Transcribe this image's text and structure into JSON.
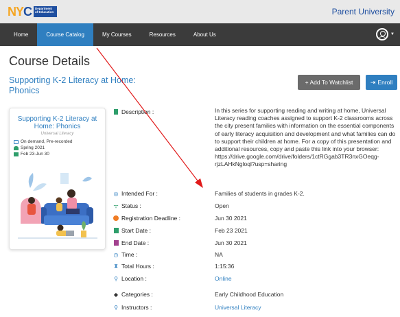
{
  "brand": {
    "logo_text": "NYC",
    "dept_text": "Department of Education",
    "site_title": "Parent University"
  },
  "nav": {
    "items": [
      {
        "label": "Home"
      },
      {
        "label": "Course Catalog"
      },
      {
        "label": "My Courses"
      },
      {
        "label": "Resources"
      },
      {
        "label": "About Us"
      }
    ],
    "active_index": 1
  },
  "page": {
    "title": "Course Details",
    "course_title": "Supporting K-2 Literacy at Home: Phonics"
  },
  "actions": {
    "watchlist_label": "+ Add To Watchlist",
    "enroll_label": "Enroll"
  },
  "card": {
    "title": "Supporting K-2 Literacy at Home: Phonics",
    "subtitle": "Universal Literacy",
    "format": "On demand, Pre-recorded",
    "term": "Spring 2021",
    "dates": "Feb 23-Jun 30"
  },
  "details": {
    "description_label": "Description :",
    "description": "In this series for supporting reading and writing at home, Universal Literacy reading coaches assigned to support K-2 classrooms across the city present families with information on the essential components of early literacy acquisition and development and what families can do to support their children at home. For a copy of this presentation and additional resources, copy and paste this link into your browser: https://drive.google.com/drive/folders/1ctRGgab3TR3nxGOeqg-rjzLAHkNgloql?usp=sharing",
    "rows": [
      {
        "label": "Intended For :",
        "value": "Families of students in grades K-2.",
        "icon": "person-circle-icon",
        "color": "#2f7fc0"
      },
      {
        "label": "Status :",
        "value": "Open",
        "icon": "wifi-icon",
        "color": "#2e9e6b"
      },
      {
        "label": "Registration Deadline :",
        "value": "Jun 30 2021",
        "icon": "alert-icon",
        "color": "#f07c24"
      },
      {
        "label": "Start Date :",
        "value": "Feb 23 2021",
        "icon": "calendar-start-icon",
        "color": "#2e9e6b"
      },
      {
        "label": "End Date :",
        "value": "Jun 30 2021",
        "icon": "calendar-end-icon",
        "color": "#a3428f"
      },
      {
        "label": "Time :",
        "value": "NA",
        "icon": "clock-icon",
        "color": "#2f7fc0"
      },
      {
        "label": "Total Hours :",
        "value": "1:15:36",
        "icon": "hourglass-icon",
        "color": "#2f7fc0"
      },
      {
        "label": "Location :",
        "value": "Online",
        "icon": "location-pin-icon",
        "color": "#2f7fc0",
        "link": true
      },
      {
        "label": "Categories :",
        "value": "Early Childhood Education",
        "icon": "tag-icon",
        "color": "#333333"
      },
      {
        "label": "Instructors :",
        "value": "Universal Literacy",
        "icon": "location-pin-icon",
        "color": "#2f7fc0",
        "link": true
      }
    ]
  },
  "colors": {
    "accent": "#2f7fc0",
    "nav_bg": "#3b3b3b",
    "annotation_arrow": "#e11b1b"
  }
}
